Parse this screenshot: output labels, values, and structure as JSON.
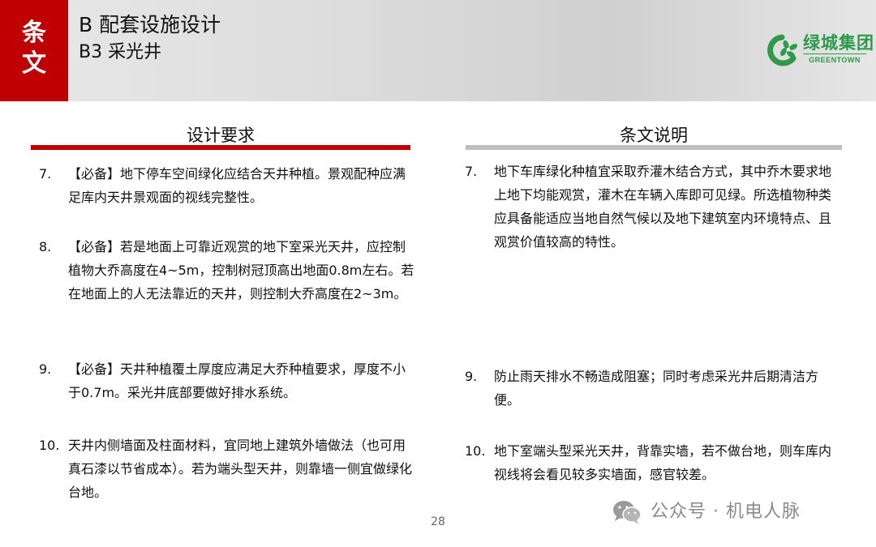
{
  "header": {
    "side_label_1": "条",
    "side_label_2": "文",
    "title": "B 配套设施设计",
    "subtitle": "B3 采光井",
    "logo_name": "绿城集团",
    "logo_sub": "GREENTOWN"
  },
  "left": {
    "heading": "设计要求",
    "items": [
      {
        "num": "7.",
        "text": "【必备】地下停车空间绿化应结合天井种植。景观配种应满足库内天井景观面的视线完整性。"
      },
      {
        "num": "8.",
        "text": "【必备】若是地面上可靠近观赏的地下室采光天井，应控制植物大乔高度在4~5m，控制树冠顶高出地面0.8m左右。若在地面上的人无法靠近的天井，则控制大乔高度在2~3m。"
      },
      {
        "num": "9.",
        "text": "【必备】天井种植覆土厚度应满足大乔种植要求，厚度不小于0.7m。采光井底部要做好排水系统。"
      },
      {
        "num": "10.",
        "text": "天井内侧墙面及柱面材料，宜同地上建筑外墙做法（也可用真石漆以节省成本）。若为端头型天井，则靠墙一侧宜做绿化台地。"
      }
    ]
  },
  "right": {
    "heading": "条文说明",
    "items": [
      {
        "num": "7.",
        "text": "地下车库绿化种植宜采取乔灌木结合方式，其中乔木要求地上地下均能观赏，灌木在车辆入库即可见绿。所选植物种类应具备能适应当地自然气候以及地下建筑室内环境特点、且观赏价值较高的特性。"
      },
      {
        "num": "9.",
        "text": "防止雨天排水不畅造成阻塞；同时考虑采光井后期清洁方便。"
      },
      {
        "num": "10.",
        "text": "地下室端头型采光天井，背靠实墙，若不做台地，则车库内视线将会看见较多实墙面，感官较差。"
      }
    ]
  },
  "footer": {
    "page_number": "28",
    "watermark": "公众号 · 机电人脉"
  },
  "colors": {
    "accent_red": "#c00000",
    "brand_green": "#2e9b4b",
    "divider_gray": "#bfbfbf"
  }
}
